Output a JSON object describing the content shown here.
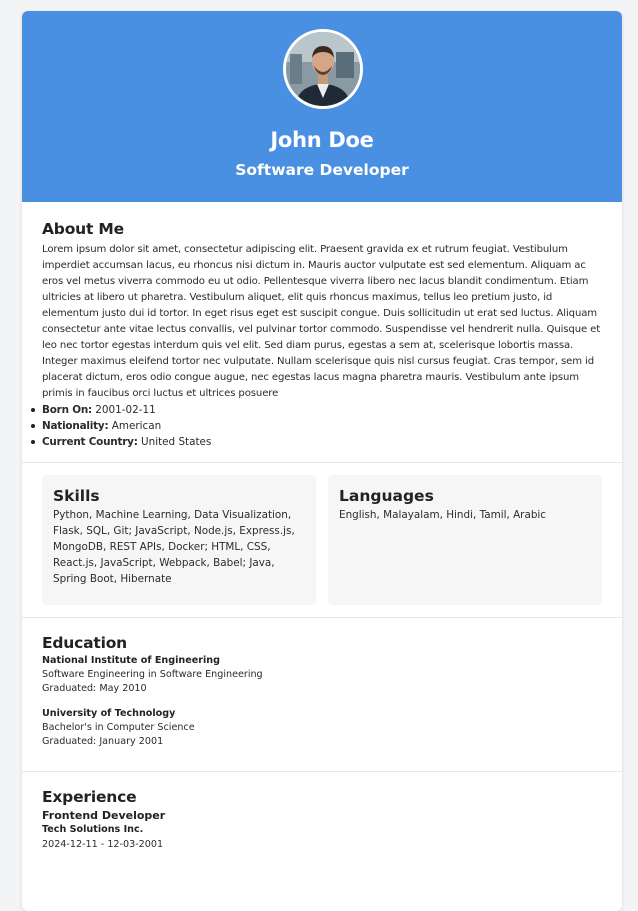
{
  "profile": {
    "name": "John Doe",
    "title": "Software Developer"
  },
  "about": {
    "heading": "About Me",
    "text": "Lorem ipsum dolor sit amet, consectetur adipiscing elit. Praesent gravida ex et rutrum feugiat. Vestibulum imperdiet accumsan lacus, eu rhoncus nisi dictum in. Mauris auctor vulputate est sed elementum. Aliquam ac eros vel metus viverra commodo eu ut odio. Pellentesque viverra libero nec lacus blandit condimentum. Etiam ultricies at libero ut pharetra. Vestibulum aliquet, elit quis rhoncus maximus, tellus leo pretium justo, id elementum justo dui id tortor. In eget risus eget est suscipit congue. Duis sollicitudin ut erat sed luctus. Aliquam consectetur ante vitae lectus convallis, vel pulvinar tortor commodo. Suspendisse vel hendrerit nulla. Quisque et leo nec tortor egestas interdum quis vel elit. Sed diam purus, egestas a sem at, scelerisque lobortis massa. Integer maximus eleifend tortor nec vulputate. Nullam scelerisque quis nisl cursus feugiat. Cras tempor, sem id placerat dictum, eros odio congue augue, nec egestas lacus magna pharetra mauris. Vestibulum ante ipsum primis in faucibus orci luctus et ultrices posuere",
    "details": [
      {
        "label": "Born On:",
        "value": "2001-02-11"
      },
      {
        "label": "Nationality:",
        "value": "American"
      },
      {
        "label": "Current Country:",
        "value": "United States"
      }
    ]
  },
  "skills": {
    "heading": "Skills",
    "text": "Python, Machine Learning, Data Visualization, Flask, SQL, Git; JavaScript, Node.js, Express.js, MongoDB, REST APIs, Docker; HTML, CSS, React.js, JavaScript, Webpack, Babel; Java, Spring Boot, Hibernate"
  },
  "languages": {
    "heading": "Languages",
    "text": "English, Malayalam, Hindi, Tamil, Arabic"
  },
  "education": {
    "heading": "Education",
    "items": [
      {
        "institution": "National Institute of Engineering",
        "degree": "Software Engineering in Software Engineering",
        "graduated": "Graduated: May 2010"
      },
      {
        "institution": "University of Technology",
        "degree": "Bachelor's in Computer Science",
        "graduated": "Graduated: January 2001"
      }
    ]
  },
  "experience": {
    "heading": "Experience",
    "items": [
      {
        "role": "Frontend Developer",
        "company": "Tech Solutions Inc.",
        "dates": "2024-12-11 - 12-03-2001"
      }
    ]
  },
  "colors": {
    "header_bg": "#4a90e2",
    "card_bg": "#ffffff",
    "box_bg": "#f6f6f6"
  }
}
